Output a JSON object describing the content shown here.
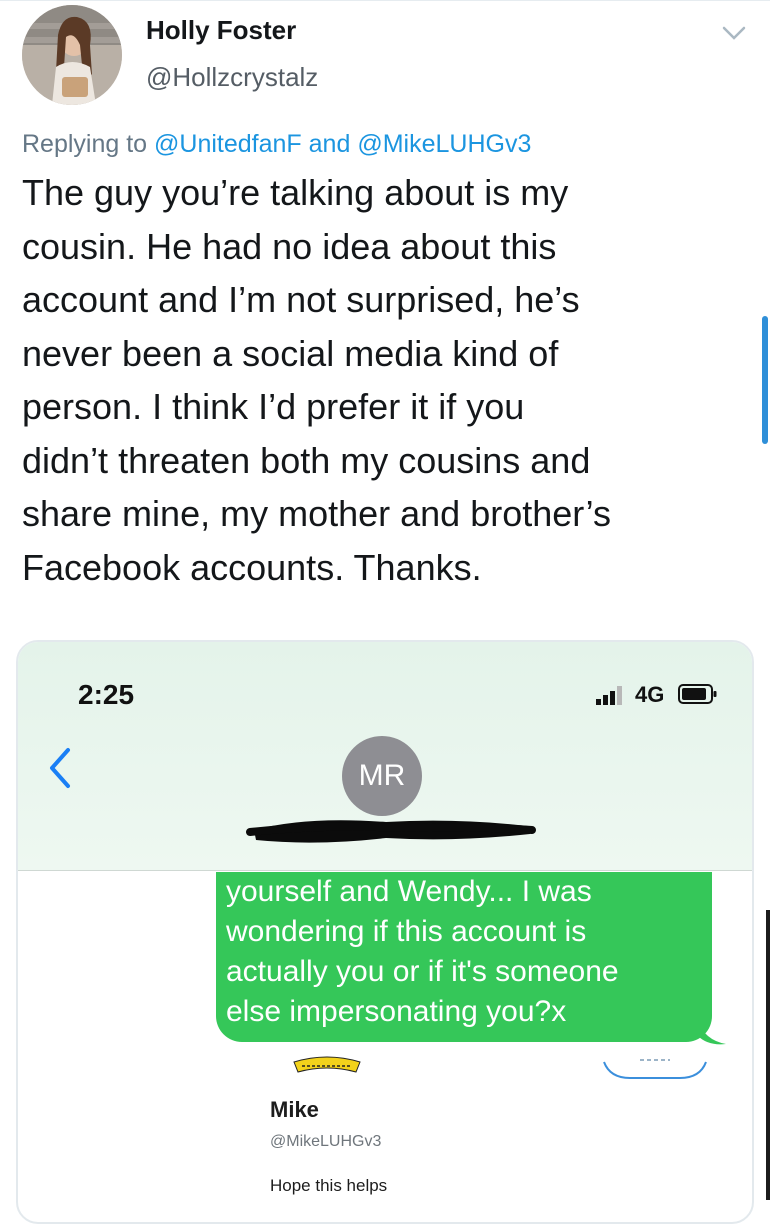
{
  "tweet": {
    "author_name": "Holly Foster",
    "author_handle": "@Hollzcrystalz",
    "replying_prefix": "Replying to",
    "replying_mention_1": "@UnitedfanF",
    "replying_conjunction": "and",
    "replying_mention_2": "@MikeLUHGv3",
    "text_lines": [
      "The guy you’re talking about is my",
      "cousin. He had no idea about this",
      "account and I’m not surprised, he’s",
      "never been a social media kind of",
      "person. I think I’d prefer it if you",
      "didn’t threaten both my cousins and",
      "share mine, my mother and brother’s",
      "Facebook accounts. Thanks."
    ],
    "menu_icon": "chevron-down-icon"
  },
  "screenshot": {
    "time": "2:25",
    "network": "4G",
    "contact_initials": "MR",
    "bubble_lines": [
      "yourself and Wendy... I was",
      "wondering if this account is",
      "actually you or if it's someone",
      "else impersonating you?x"
    ],
    "embedded_name": "Mike",
    "embedded_handle": "@MikeLUHGv3",
    "embedded_text": "Hope this helps",
    "colors": {
      "bubble": "#35c759",
      "header_bg": "#e4f3ea",
      "avatar_bg": "#8e8e93"
    }
  },
  "colors": {
    "link": "#1b95e0",
    "secondary_text": "#657786"
  }
}
